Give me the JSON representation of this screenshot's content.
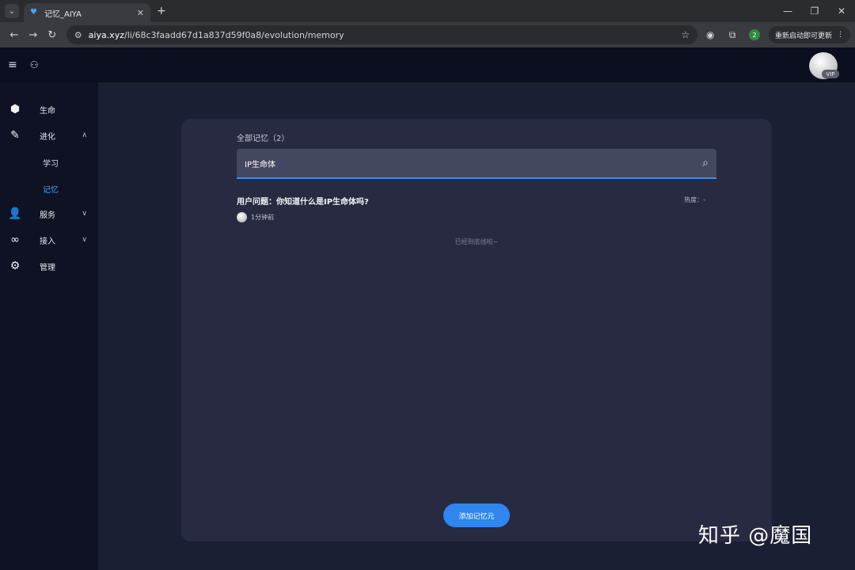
{
  "browser": {
    "tab_title": "记忆_AIYA",
    "tab_close": "✕",
    "new_tab": "+",
    "url_host": "aiya.xyz",
    "url_path": "/li/68c3faadd67d1a837d59f0a8/evolution/memory",
    "extension_badge": "2",
    "update_label": "重新启动即可更新"
  },
  "header": {
    "vip_label": "VIP"
  },
  "sidebar": {
    "items": [
      {
        "label": "生命"
      },
      {
        "label": "进化"
      },
      {
        "label": "服务"
      },
      {
        "label": "接入"
      },
      {
        "label": "管理"
      }
    ],
    "sub_items": [
      {
        "label": "学习"
      },
      {
        "label": "记忆"
      }
    ]
  },
  "main": {
    "section_title": "全部记忆（2）",
    "search_value": "IP生命体",
    "memory": {
      "question": "用户问题：你知道什么是IP生命体吗?",
      "heat": "热度：-",
      "time": "1分钟前"
    },
    "end_note": "已经到底线啦~",
    "add_button": "添加记忆元"
  },
  "watermark": "知乎 @魔国"
}
